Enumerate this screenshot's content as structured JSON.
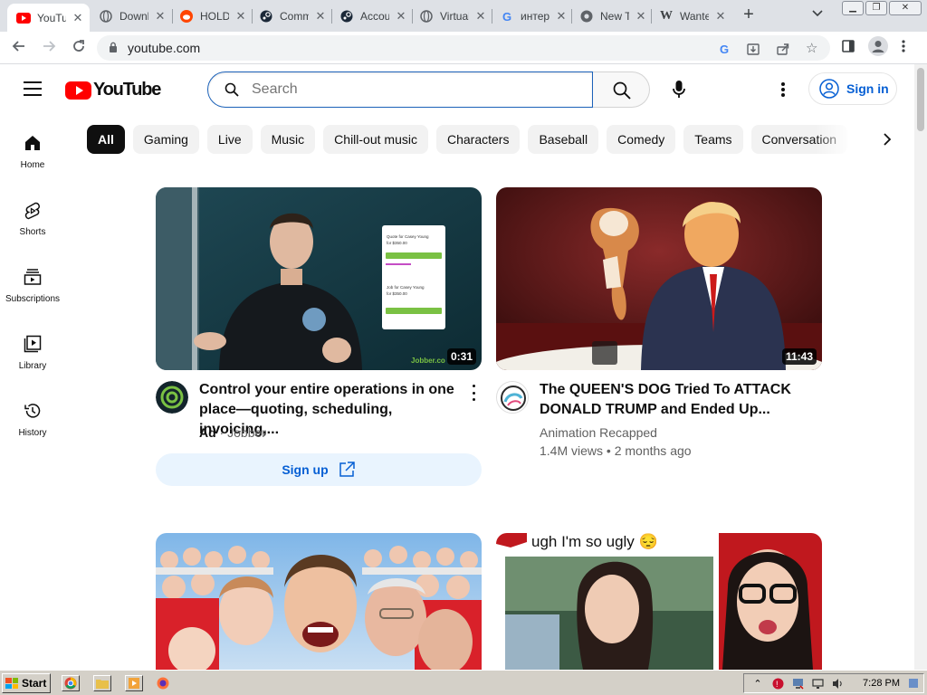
{
  "browser": {
    "tabs": [
      {
        "title": "YouTube",
        "favicon": "youtube-icon",
        "active": true
      },
      {
        "title": "Download",
        "favicon": "globe-icon"
      },
      {
        "title": "HOLD",
        "favicon": "reddit-icon"
      },
      {
        "title": "Community",
        "favicon": "steam-icon"
      },
      {
        "title": "Account",
        "favicon": "steam-icon"
      },
      {
        "title": "Virtual",
        "favicon": "globe-icon"
      },
      {
        "title": "интернет",
        "favicon": "google-icon"
      },
      {
        "title": "New Tab",
        "favicon": "chrome-icon"
      },
      {
        "title": "Wanted",
        "favicon": "wikipedia-icon"
      }
    ],
    "url": "youtube.com"
  },
  "header": {
    "logo_text": "YouTube",
    "search_placeholder": "Search",
    "signin_label": "Sign in"
  },
  "chips": [
    "All",
    "Gaming",
    "Live",
    "Music",
    "Chill-out music",
    "Characters",
    "Baseball",
    "Comedy",
    "Teams",
    "Conversation"
  ],
  "sidebar": [
    {
      "label": "Home",
      "icon": "home-icon"
    },
    {
      "label": "Shorts",
      "icon": "shorts-icon"
    },
    {
      "label": "Subscriptions",
      "icon": "subscriptions-icon"
    },
    {
      "label": "Library",
      "icon": "library-icon"
    },
    {
      "label": "History",
      "icon": "history-icon"
    }
  ],
  "videos": [
    {
      "title": "Control your entire operations in one place—quoting, scheduling, invoicing,...",
      "duration": "0:31",
      "ad_label": "Ad",
      "channel": "Jobber",
      "cta": "Sign up",
      "thumb_text": {
        "quote": "Quote for Casey Young",
        "quote_price": "for $350.00",
        "job": "Job for Casey Young",
        "job_price": "for $350.00",
        "watermark": "Jobber.co"
      }
    },
    {
      "title": "The QUEEN'S DOG Tried To ATTACK DONALD TRUMP and Ended Up...",
      "duration": "11:43",
      "channel": "Animation Recapped",
      "views": "1.4M views",
      "age": "2 months ago"
    },
    {
      "title": ""
    },
    {
      "title": "",
      "thumb_caption": "ugh I'm so ugly 😔"
    }
  ],
  "taskbar": {
    "start_label": "Start",
    "clock": "7:28 PM"
  },
  "colors": {
    "yt_red": "#ff0000",
    "link_blue": "#065fd4",
    "chip_bg": "#f2f2f2"
  }
}
